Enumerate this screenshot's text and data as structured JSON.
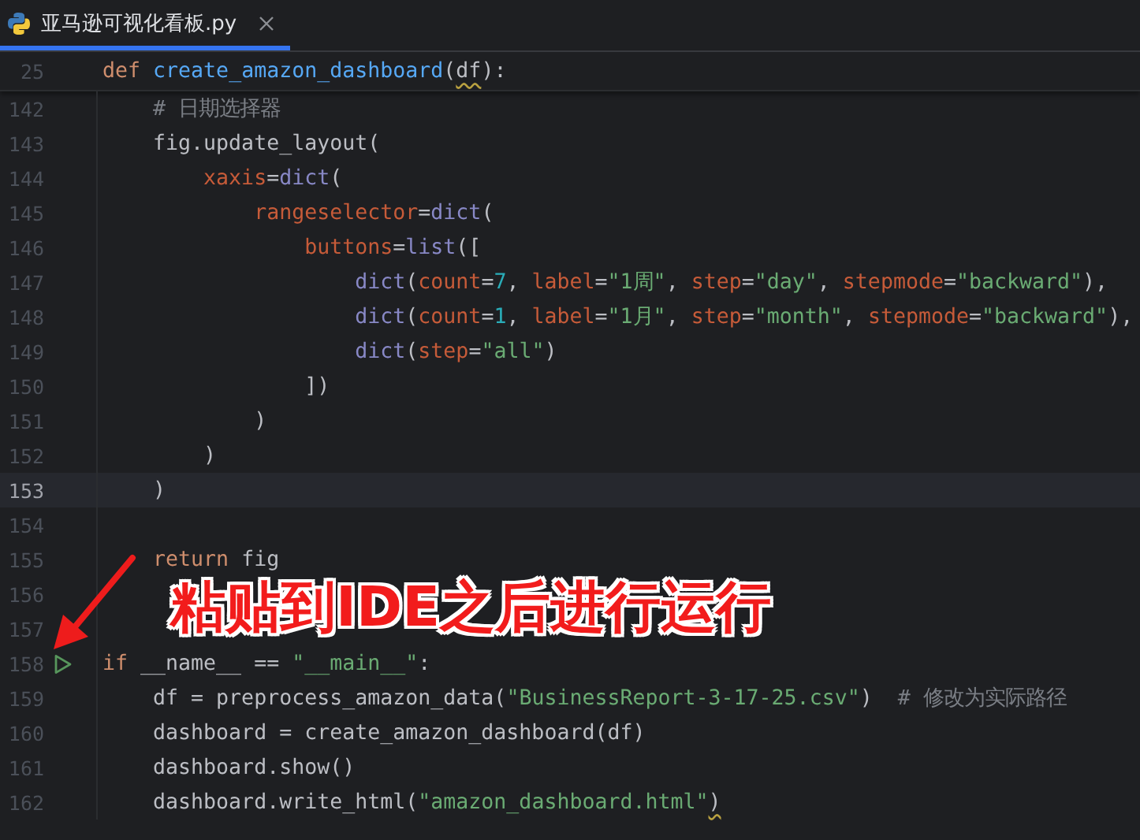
{
  "tab": {
    "title": "亚马逊可视化看板.py",
    "selected": true
  },
  "sticky_line": {
    "number": "25",
    "tokens": [
      {
        "text": "def ",
        "kind": "keyword"
      },
      {
        "text": "create_amazon_dashboard",
        "kind": "function"
      },
      {
        "text": "(",
        "kind": "plain"
      },
      {
        "text": "df",
        "kind": "plain",
        "warn": true
      },
      {
        "text": "):",
        "kind": "plain"
      }
    ]
  },
  "lines": [
    {
      "number": "142",
      "current": false,
      "run": false,
      "tokens": [
        {
          "text": "    # 日期选择器",
          "kind": "comment"
        }
      ]
    },
    {
      "number": "143",
      "current": false,
      "run": false,
      "tokens": [
        {
          "text": "    fig.update_layout(",
          "kind": "plain"
        }
      ]
    },
    {
      "number": "144",
      "current": false,
      "run": false,
      "tokens": [
        {
          "text": "        xaxis",
          "kind": "kwarg"
        },
        {
          "text": "=",
          "kind": "plain"
        },
        {
          "text": "dict",
          "kind": "builtin"
        },
        {
          "text": "(",
          "kind": "plain"
        }
      ]
    },
    {
      "number": "145",
      "current": false,
      "run": false,
      "tokens": [
        {
          "text": "            rangeselector",
          "kind": "kwarg"
        },
        {
          "text": "=",
          "kind": "plain"
        },
        {
          "text": "dict",
          "kind": "builtin"
        },
        {
          "text": "(",
          "kind": "plain"
        }
      ]
    },
    {
      "number": "146",
      "current": false,
      "run": false,
      "tokens": [
        {
          "text": "                buttons",
          "kind": "kwarg"
        },
        {
          "text": "=",
          "kind": "plain"
        },
        {
          "text": "list",
          "kind": "builtin"
        },
        {
          "text": "([",
          "kind": "plain"
        }
      ]
    },
    {
      "number": "147",
      "current": false,
      "run": false,
      "tokens": [
        {
          "text": "                    dict",
          "kind": "builtin"
        },
        {
          "text": "(",
          "kind": "plain"
        },
        {
          "text": "count",
          "kind": "kwarg"
        },
        {
          "text": "=",
          "kind": "plain"
        },
        {
          "text": "7",
          "kind": "number"
        },
        {
          "text": ", ",
          "kind": "plain"
        },
        {
          "text": "label",
          "kind": "kwarg"
        },
        {
          "text": "=",
          "kind": "plain"
        },
        {
          "text": "\"1周\"",
          "kind": "string"
        },
        {
          "text": ", ",
          "kind": "plain"
        },
        {
          "text": "step",
          "kind": "kwarg"
        },
        {
          "text": "=",
          "kind": "plain"
        },
        {
          "text": "\"day\"",
          "kind": "string"
        },
        {
          "text": ", ",
          "kind": "plain"
        },
        {
          "text": "stepmode",
          "kind": "kwarg"
        },
        {
          "text": "=",
          "kind": "plain"
        },
        {
          "text": "\"backward\"",
          "kind": "string"
        },
        {
          "text": "),",
          "kind": "plain"
        }
      ]
    },
    {
      "number": "148",
      "current": false,
      "run": false,
      "tokens": [
        {
          "text": "                    dict",
          "kind": "builtin"
        },
        {
          "text": "(",
          "kind": "plain"
        },
        {
          "text": "count",
          "kind": "kwarg"
        },
        {
          "text": "=",
          "kind": "plain"
        },
        {
          "text": "1",
          "kind": "number"
        },
        {
          "text": ", ",
          "kind": "plain"
        },
        {
          "text": "label",
          "kind": "kwarg"
        },
        {
          "text": "=",
          "kind": "plain"
        },
        {
          "text": "\"1月\"",
          "kind": "string"
        },
        {
          "text": ", ",
          "kind": "plain"
        },
        {
          "text": "step",
          "kind": "kwarg"
        },
        {
          "text": "=",
          "kind": "plain"
        },
        {
          "text": "\"month\"",
          "kind": "string"
        },
        {
          "text": ", ",
          "kind": "plain"
        },
        {
          "text": "stepmode",
          "kind": "kwarg"
        },
        {
          "text": "=",
          "kind": "plain"
        },
        {
          "text": "\"backward\"",
          "kind": "string"
        },
        {
          "text": "),",
          "kind": "plain"
        }
      ]
    },
    {
      "number": "149",
      "current": false,
      "run": false,
      "tokens": [
        {
          "text": "                    dict",
          "kind": "builtin"
        },
        {
          "text": "(",
          "kind": "plain"
        },
        {
          "text": "step",
          "kind": "kwarg"
        },
        {
          "text": "=",
          "kind": "plain"
        },
        {
          "text": "\"all\"",
          "kind": "string"
        },
        {
          "text": ")",
          "kind": "plain"
        }
      ]
    },
    {
      "number": "150",
      "current": false,
      "run": false,
      "tokens": [
        {
          "text": "                ])",
          "kind": "plain"
        }
      ]
    },
    {
      "number": "151",
      "current": false,
      "run": false,
      "tokens": [
        {
          "text": "            )",
          "kind": "plain"
        }
      ]
    },
    {
      "number": "152",
      "current": false,
      "run": false,
      "tokens": [
        {
          "text": "        )",
          "kind": "plain"
        }
      ]
    },
    {
      "number": "153",
      "current": true,
      "run": false,
      "tokens": [
        {
          "text": "    )",
          "kind": "plain"
        }
      ]
    },
    {
      "number": "154",
      "current": false,
      "run": false
    },
    {
      "number": "155",
      "current": false,
      "run": false,
      "tokens": [
        {
          "text": "    return",
          "kind": "keyword"
        },
        {
          "text": " fig",
          "kind": "plain"
        }
      ]
    },
    {
      "number": "156",
      "current": false,
      "run": false
    },
    {
      "number": "157",
      "current": false,
      "run": false
    },
    {
      "number": "158",
      "current": false,
      "run": true,
      "tokens": [
        {
          "text": "if",
          "kind": "keyword"
        },
        {
          "text": " __name__ == ",
          "kind": "plain"
        },
        {
          "text": "\"__main__\"",
          "kind": "string"
        },
        {
          "text": ":",
          "kind": "plain"
        }
      ]
    },
    {
      "number": "159",
      "current": false,
      "run": false,
      "tokens": [
        {
          "text": "    df = preprocess_amazon_data(",
          "kind": "plain"
        },
        {
          "text": "\"BusinessReport-3-17-25.csv\"",
          "kind": "string"
        },
        {
          "text": ")  ",
          "kind": "plain"
        },
        {
          "text": "# 修改为实际路径",
          "kind": "comment"
        }
      ]
    },
    {
      "number": "160",
      "current": false,
      "run": false,
      "tokens": [
        {
          "text": "    dashboard = create_amazon_dashboard(df)",
          "kind": "plain"
        }
      ]
    },
    {
      "number": "161",
      "current": false,
      "run": false,
      "tokens": [
        {
          "text": "    dashboard.show()",
          "kind": "plain"
        }
      ]
    },
    {
      "number": "162",
      "current": false,
      "run": false,
      "tokens": [
        {
          "text": "    dashboard.write_html(",
          "kind": "plain"
        },
        {
          "text": "\"amazon_dashboard.html\"",
          "kind": "string"
        },
        {
          "text": ")",
          "kind": "plain",
          "warn": true
        }
      ]
    }
  ],
  "annotation": {
    "text": "粘贴到IDE之后进行运行"
  }
}
